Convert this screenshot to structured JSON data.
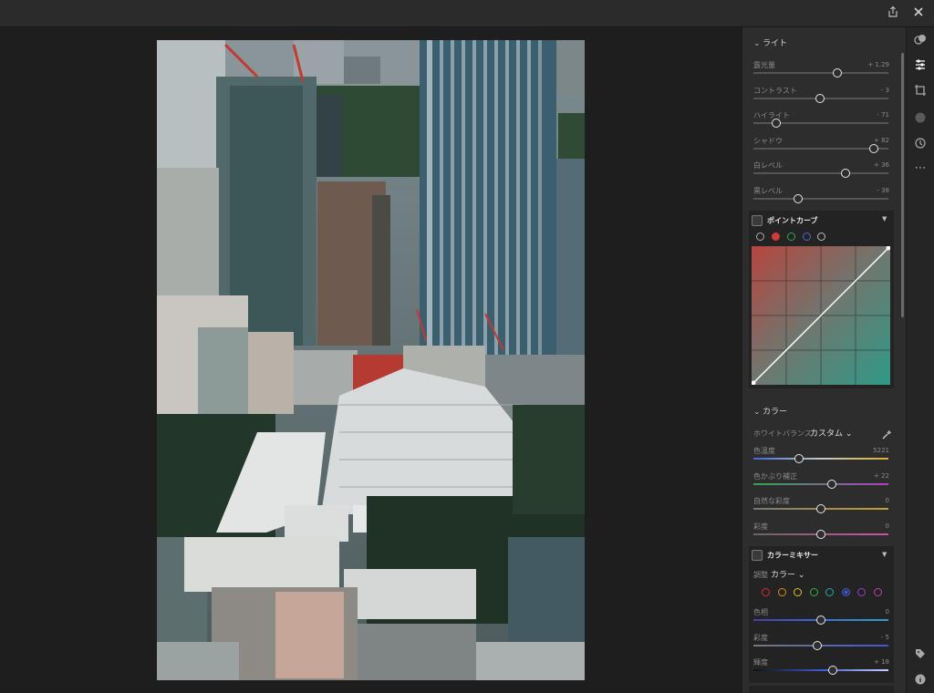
{
  "light": {
    "header": "ライト",
    "sliders": [
      {
        "label": "露光量",
        "value": "+ 1.29",
        "pos": 0.62
      },
      {
        "label": "コントラスト",
        "value": "- 3",
        "pos": 0.49
      },
      {
        "label": "ハイライト",
        "value": "- 71",
        "pos": 0.17
      },
      {
        "label": "シャドウ",
        "value": "+ 82",
        "pos": 0.89
      },
      {
        "label": "白レベル",
        "value": "+ 36",
        "pos": 0.68
      },
      {
        "label": "黒レベル",
        "value": "- 38",
        "pos": 0.33
      }
    ]
  },
  "point_curve": {
    "title": "ポイントカーブ",
    "channels": [
      "all",
      "red",
      "green",
      "blue",
      "custom"
    ]
  },
  "color": {
    "header": "カラー",
    "wb_label": "ホワイトバランス",
    "wb_value": "カスタム",
    "sliders": [
      {
        "label": "色温度",
        "value": "5221",
        "pos": 0.34
      },
      {
        "label": "色かぶり補正",
        "value": "+ 22",
        "pos": 0.58
      },
      {
        "label": "自然な彩度",
        "value": "0",
        "pos": 0.5
      },
      {
        "label": "彩度",
        "value": "0",
        "pos": 0.5
      }
    ]
  },
  "color_mixer": {
    "title": "カラーミキサー",
    "adjust_label": "調整",
    "adjust_value": "カラー",
    "swatches": [
      "#d03030",
      "#e08a20",
      "#d8c820",
      "#38b038",
      "#20b0a0",
      "#3a5ad8",
      "#9040d0",
      "#c040b0"
    ],
    "selected_swatch": 5,
    "sliders": [
      {
        "label": "色相",
        "value": "0",
        "pos": 0.5
      },
      {
        "label": "彩度",
        "value": "- 5",
        "pos": 0.47
      },
      {
        "label": "輝度",
        "value": "+ 18",
        "pos": 0.59
      }
    ]
  },
  "icons": {
    "share": "share-icon",
    "close": "close-icon",
    "presets": "presets-icon",
    "edit": "edit-sliders-icon",
    "crop": "crop-icon",
    "masking": "masking-icon",
    "history": "history-icon",
    "more": "more-icon",
    "tag": "tag-icon",
    "info": "info-icon"
  }
}
